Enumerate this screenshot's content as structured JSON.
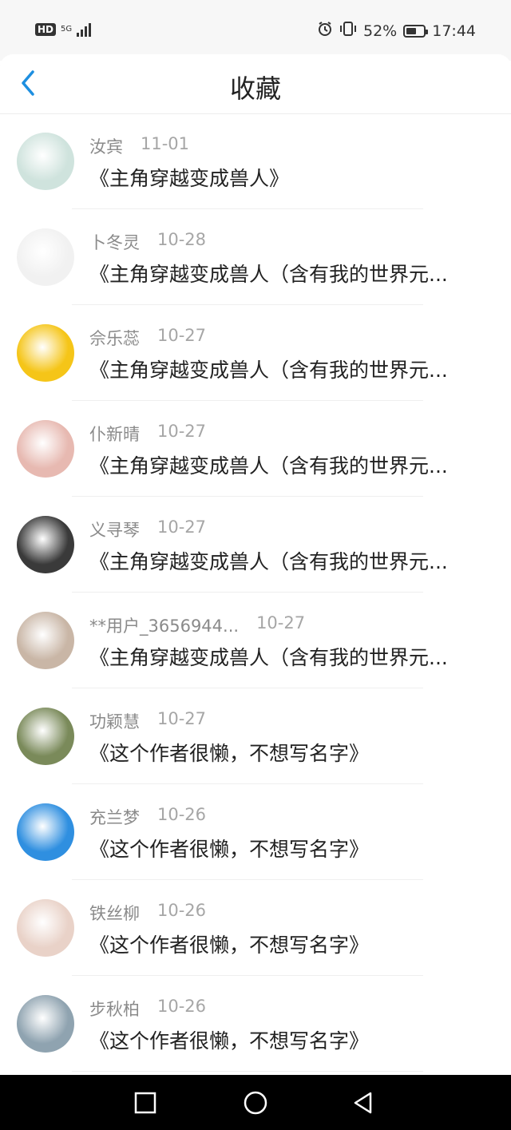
{
  "status_bar": {
    "hd": "HD",
    "network": "5G",
    "battery_percent": "52%",
    "time": "17:44"
  },
  "header": {
    "title": "收藏"
  },
  "items": [
    {
      "name": "汝宾",
      "date": "11-01",
      "book": "《主角穿越变成兽人》",
      "avatar_color": "#cfe3dd"
    },
    {
      "name": "卜冬灵",
      "date": "10-28",
      "book": "《主角穿越变成兽人（含有我的世界元...",
      "avatar_color": "#f1f1f1"
    },
    {
      "name": "佘乐蕊",
      "date": "10-27",
      "book": "《主角穿越变成兽人（含有我的世界元...",
      "avatar_color": "#f5c518"
    },
    {
      "name": "仆新晴",
      "date": "10-27",
      "book": "《主角穿越变成兽人（含有我的世界元...",
      "avatar_color": "#e7b9b1"
    },
    {
      "name": "义寻琴",
      "date": "10-27",
      "book": "《主角穿越变成兽人（含有我的世界元...",
      "avatar_color": "#3a3a3a"
    },
    {
      "name": "**用户_3656944...",
      "date": "10-27",
      "book": "《主角穿越变成兽人（含有我的世界元...",
      "avatar_color": "#c9b6a6"
    },
    {
      "name": "功颖慧",
      "date": "10-27",
      "book": "《这个作者很懒，不想写名字》",
      "avatar_color": "#7a8a5a"
    },
    {
      "name": "充兰梦",
      "date": "10-26",
      "book": "《这个作者很懒，不想写名字》",
      "avatar_color": "#2f8fe0"
    },
    {
      "name": "铁丝柳",
      "date": "10-26",
      "book": "《这个作者很懒，不想写名字》",
      "avatar_color": "#e9d2c8"
    },
    {
      "name": "步秋柏",
      "date": "10-26",
      "book": "《这个作者很懒，不想写名字》",
      "avatar_color": "#8fa3b0"
    }
  ],
  "icons": {
    "back": "chevron-left-icon",
    "alarm": "alarm-icon",
    "vibrate": "vibrate-icon",
    "battery": "battery-icon",
    "nav_recent": "square-icon",
    "nav_home": "circle-icon",
    "nav_back": "triangle-back-icon"
  },
  "colors": {
    "accent": "#1e8fe0",
    "name_text": "#8a8a8a",
    "book_text": "#222222",
    "nav_bg": "#000000"
  }
}
